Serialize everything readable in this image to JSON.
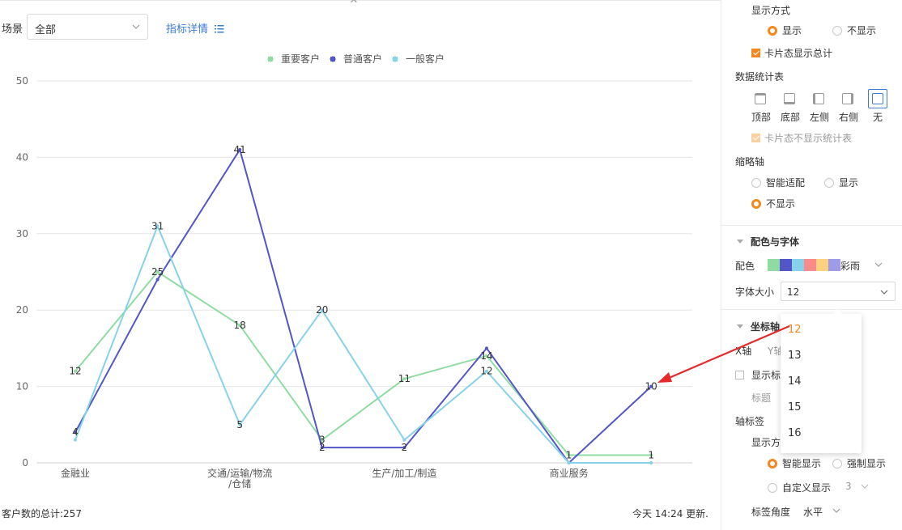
{
  "header": {
    "scene_label": "场景",
    "scene_value": "全部",
    "detail_link": "指标详情"
  },
  "footer": {
    "total": "客户数的总计:257",
    "update": "今天 14:24 更新."
  },
  "colors": {
    "important": "#8fdca3",
    "normal": "#5356c6",
    "general": "#86d2ea",
    "accent": "#f5871f",
    "link": "#3d7ad6"
  },
  "chart_data": {
    "type": "line",
    "categories": [
      "金融业",
      "",
      "交通/运输/物流/仓储",
      "",
      "生产/加工/制造",
      "",
      "商业服务",
      ""
    ],
    "category_label_lines": [
      [
        "金融业"
      ],
      [],
      [
        "交通/运输/物流",
        "/仓储"
      ],
      [],
      [
        "生产/加工/制造"
      ],
      [],
      [
        "商业服务"
      ],
      []
    ],
    "series": [
      {
        "name": "重要客户",
        "color": "#8fdca3",
        "values": [
          12,
          25,
          18,
          3,
          11,
          14,
          1,
          1
        ]
      },
      {
        "name": "普通客户",
        "color": "#5356c6",
        "values": [
          4,
          24,
          41,
          2,
          2,
          15,
          0,
          10
        ]
      },
      {
        "name": "一般客户",
        "color": "#86d2ea",
        "values": [
          3,
          31,
          5,
          20,
          3,
          12,
          0,
          0
        ]
      }
    ],
    "data_labels": [
      {
        "series": 0,
        "index": 0,
        "text": "12"
      },
      {
        "series": 0,
        "index": 1,
        "text": "25"
      },
      {
        "series": 0,
        "index": 2,
        "text": "18"
      },
      {
        "series": 0,
        "index": 3,
        "text": "3"
      },
      {
        "series": 0,
        "index": 4,
        "text": "11"
      },
      {
        "series": 0,
        "index": 5,
        "text": "14"
      },
      {
        "series": 0,
        "index": 6,
        "text": "1"
      },
      {
        "series": 0,
        "index": 7,
        "text": "1"
      },
      {
        "series": 1,
        "index": 0,
        "text": "4"
      },
      {
        "series": 1,
        "index": 2,
        "text": "41"
      },
      {
        "series": 1,
        "index": 3,
        "text": "2"
      },
      {
        "series": 1,
        "index": 4,
        "text": "2"
      },
      {
        "series": 1,
        "index": 7,
        "text": "10"
      },
      {
        "series": 2,
        "index": 1,
        "text": "31"
      },
      {
        "series": 2,
        "index": 2,
        "text": "5"
      },
      {
        "series": 2,
        "index": 3,
        "text": "20"
      },
      {
        "series": 2,
        "index": 5,
        "text": "12"
      }
    ],
    "y_ticks": [
      "0",
      "10",
      "20",
      "30",
      "40",
      "50"
    ],
    "ylim": [
      0,
      50
    ],
    "grid": true,
    "legend_position": "top-center",
    "title": "",
    "xlabel": "",
    "ylabel": ""
  },
  "panel": {
    "display_mode_title": "显示方式",
    "display_show": "显示",
    "display_hide": "不显示",
    "card_total": "卡片态显示总计",
    "stats_table_title": "数据统计表",
    "pos_top": "顶部",
    "pos_bottom": "底部",
    "pos_left": "左侧",
    "pos_right": "右侧",
    "pos_none": "无",
    "card_no_stats": "卡片态不显示统计表",
    "thumb_axis_title": "缩略轴",
    "thumb_smart": "智能适配",
    "thumb_show": "显示",
    "thumb_hide": "不显示",
    "color_font_title": "配色与字体",
    "color_label": "配色",
    "color_scheme_name": "彩雨",
    "swatches": [
      "#8fdca3",
      "#5356c6",
      "#86d2ea",
      "#f98b8b",
      "#fbd27f",
      "#9e9ce8"
    ],
    "font_size_label": "字体大小",
    "font_size_value": "12",
    "axis_title": "坐标轴",
    "axis_x_tab": "X轴",
    "axis_y_tab": "Y轴",
    "show_title_label": "显示标",
    "title_label": "标题",
    "axis_label_title": "轴标签",
    "display_mode_partial": "显示方",
    "smart_display": "智能显示",
    "force_display": "强制显示",
    "custom_display": "自定义显示",
    "custom_value": "3",
    "label_angle_label": "标签角度",
    "label_angle_value": "水平"
  },
  "font_dropdown": {
    "options": [
      "12",
      "13",
      "14",
      "15",
      "16"
    ],
    "selected": "12"
  }
}
